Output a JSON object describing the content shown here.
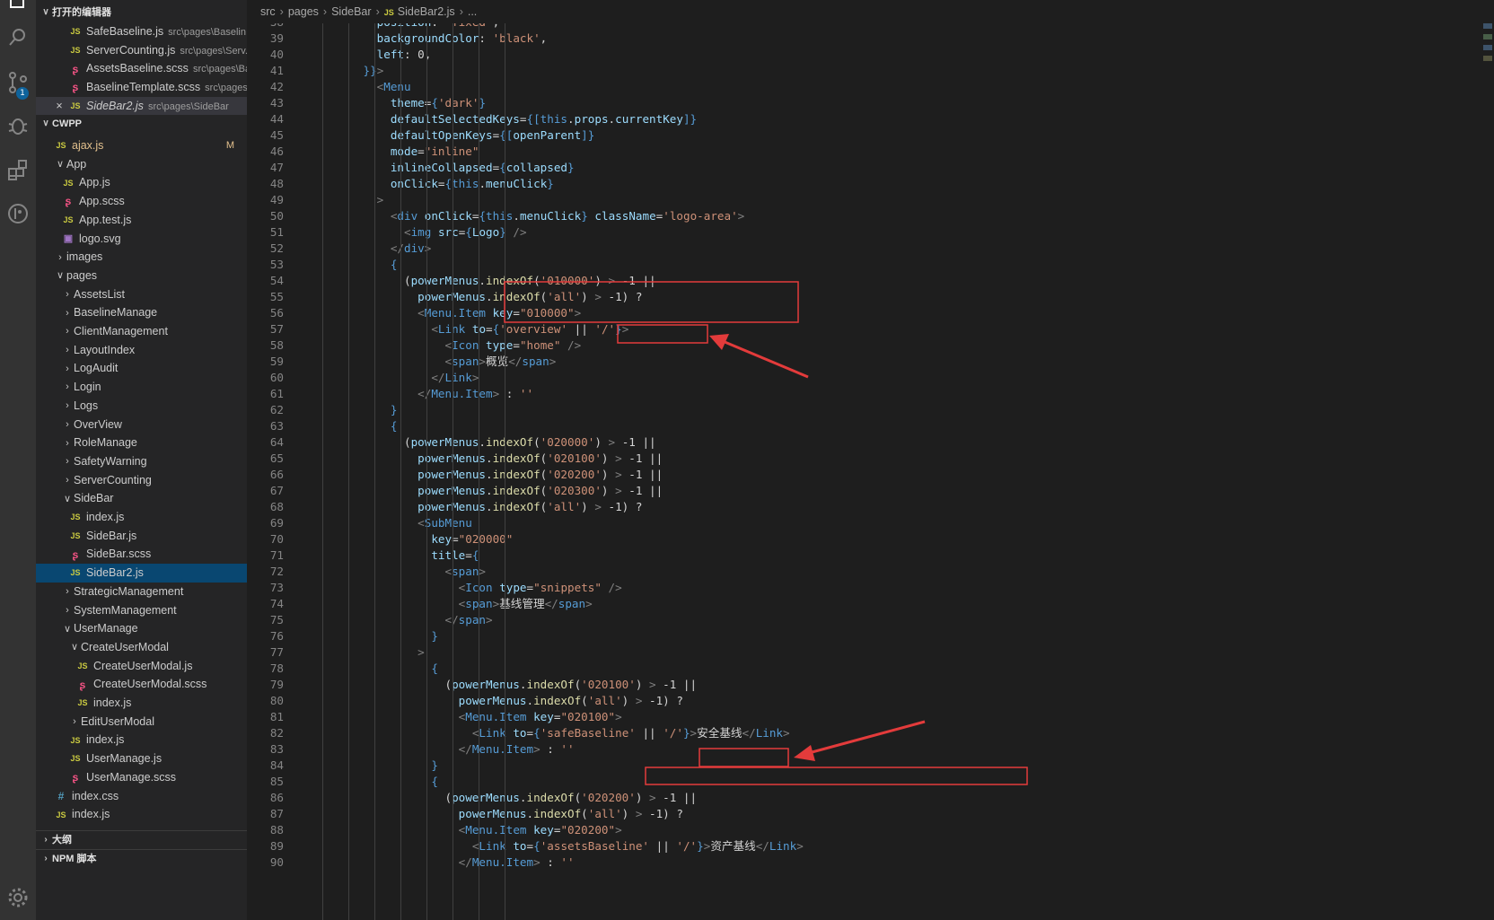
{
  "sidebar": {
    "open_editors_title": "打开的编辑器",
    "open_editors": [
      {
        "name": "SafeBaseline.js",
        "path": "src\\pages\\Baselin...",
        "type": "js"
      },
      {
        "name": "ServerCounting.js",
        "path": "src\\pages\\Serv...",
        "type": "js"
      },
      {
        "name": "AssetsBaseline.scss",
        "path": "src\\pages\\Ba...",
        "type": "scss"
      },
      {
        "name": "BaselineTemplate.scss",
        "path": "src\\pages...",
        "type": "scss"
      },
      {
        "name": "SideBar2.js",
        "path": "src\\pages\\SideBar",
        "type": "js",
        "active": true
      }
    ],
    "workspace_title": "CWPP",
    "tree": [
      {
        "label": "ajax.js",
        "type": "js",
        "depth": 1,
        "git": "M"
      },
      {
        "label": "App",
        "type": "folder-open",
        "depth": 1
      },
      {
        "label": "App.js",
        "type": "js",
        "depth": 2
      },
      {
        "label": "App.scss",
        "type": "scss",
        "depth": 2
      },
      {
        "label": "App.test.js",
        "type": "js",
        "depth": 2
      },
      {
        "label": "logo.svg",
        "type": "svg",
        "depth": 2
      },
      {
        "label": "images",
        "type": "folder",
        "depth": 1
      },
      {
        "label": "pages",
        "type": "folder-open",
        "depth": 1
      },
      {
        "label": "AssetsList",
        "type": "folder",
        "depth": 2
      },
      {
        "label": "BaselineManage",
        "type": "folder",
        "depth": 2
      },
      {
        "label": "ClientManagement",
        "type": "folder",
        "depth": 2
      },
      {
        "label": "LayoutIndex",
        "type": "folder",
        "depth": 2
      },
      {
        "label": "LogAudit",
        "type": "folder",
        "depth": 2
      },
      {
        "label": "Login",
        "type": "folder",
        "depth": 2
      },
      {
        "label": "Logs",
        "type": "folder",
        "depth": 2
      },
      {
        "label": "OverView",
        "type": "folder",
        "depth": 2
      },
      {
        "label": "RoleManage",
        "type": "folder",
        "depth": 2
      },
      {
        "label": "SafetyWarning",
        "type": "folder",
        "depth": 2
      },
      {
        "label": "ServerCounting",
        "type": "folder",
        "depth": 2
      },
      {
        "label": "SideBar",
        "type": "folder-open",
        "depth": 2
      },
      {
        "label": "index.js",
        "type": "js",
        "depth": 3
      },
      {
        "label": "SideBar.js",
        "type": "js",
        "depth": 3
      },
      {
        "label": "SideBar.scss",
        "type": "scss",
        "depth": 3
      },
      {
        "label": "SideBar2.js",
        "type": "js",
        "depth": 3,
        "selected": true
      },
      {
        "label": "StrategicManagement",
        "type": "folder",
        "depth": 2
      },
      {
        "label": "SystemManagement",
        "type": "folder",
        "depth": 2
      },
      {
        "label": "UserManage",
        "type": "folder-open",
        "depth": 2
      },
      {
        "label": "CreateUserModal",
        "type": "folder-open",
        "depth": 3
      },
      {
        "label": "CreateUserModal.js",
        "type": "js",
        "depth": 4
      },
      {
        "label": "CreateUserModal.scss",
        "type": "scss",
        "depth": 4
      },
      {
        "label": "index.js",
        "type": "js",
        "depth": 4
      },
      {
        "label": "EditUserModal",
        "type": "folder",
        "depth": 3
      },
      {
        "label": "index.js",
        "type": "js",
        "depth": 3
      },
      {
        "label": "UserManage.js",
        "type": "js",
        "depth": 3
      },
      {
        "label": "UserManage.scss",
        "type": "scss",
        "depth": 3
      },
      {
        "label": "index.css",
        "type": "css",
        "depth": 1
      },
      {
        "label": "index.js",
        "type": "js",
        "depth": 1
      }
    ],
    "outline_title": "大纲",
    "npm_title": "NPM 脚本"
  },
  "activity_bar": {
    "icons": [
      "explorer-icon",
      "search-icon",
      "source-control-icon",
      "debug-icon",
      "extensions-icon",
      "git-history-icon",
      "settings-gear-icon"
    ],
    "scm_badge": "1"
  },
  "breadcrumb": {
    "parts": [
      "src",
      "pages",
      "SideBar"
    ],
    "file": "SideBar2.js",
    "tail": "..."
  },
  "editor": {
    "first_line": 38,
    "lines": [
      "        position: 'fixed',",
      "        backgroundColor: 'black',",
      "        left: 0,",
      "      }}>",
      "        <Menu",
      "          theme={'dark'}",
      "          defaultSelectedKeys={[this.props.currentKey]}",
      "          defaultOpenKeys={[openParent]}",
      "          mode=\"inline\"",
      "          inlineCollapsed={collapsed}",
      "          onClick={this.menuClick}",
      "        >",
      "          <div onClick={this.menuClick} className='logo-area'>",
      "            <img src={Logo} />",
      "          </div>",
      "          {",
      "            (powerMenus.indexOf('010000') > -1 ||",
      "              powerMenus.indexOf('all') > -1) ?",
      "              <Menu.Item key=\"010000\">",
      "                <Link to={'overview' || '/'}>",
      "                  <Icon type=\"home\" />",
      "                  <span>概览</span>",
      "                </Link>",
      "              </Menu.Item> : ''",
      "          }",
      "          {",
      "            (powerMenus.indexOf('020000') > -1 ||",
      "              powerMenus.indexOf('020100') > -1 ||",
      "              powerMenus.indexOf('020200') > -1 ||",
      "              powerMenus.indexOf('020300') > -1 ||",
      "              powerMenus.indexOf('all') > -1) ?",
      "              <SubMenu",
      "                key=\"020000\"",
      "                title={",
      "                  <span>",
      "                    <Icon type=\"snippets\" />",
      "                    <span>基线管理</span>",
      "                  </span>",
      "                }",
      "              >",
      "                {",
      "                  (powerMenus.indexOf('020100') > -1 ||",
      "                    powerMenus.indexOf('all') > -1) ?",
      "                    <Menu.Item key=\"020100\">",
      "                      <Link to={'safeBaseline' || '/'}>安全基线</Link>",
      "                    </Menu.Item> : ''",
      "                }",
      "                {",
      "                  (powerMenus.indexOf('020200') > -1 ||",
      "                    powerMenus.indexOf('all') > -1) ?",
      "                    <Menu.Item key=\"020200\">",
      "                      <Link to={'assetsBaseline' || '/'}>资产基线</Link>",
      "                    </Menu.Item> : ''"
    ]
  },
  "annotations": {
    "box_color": "#e33b3b"
  }
}
